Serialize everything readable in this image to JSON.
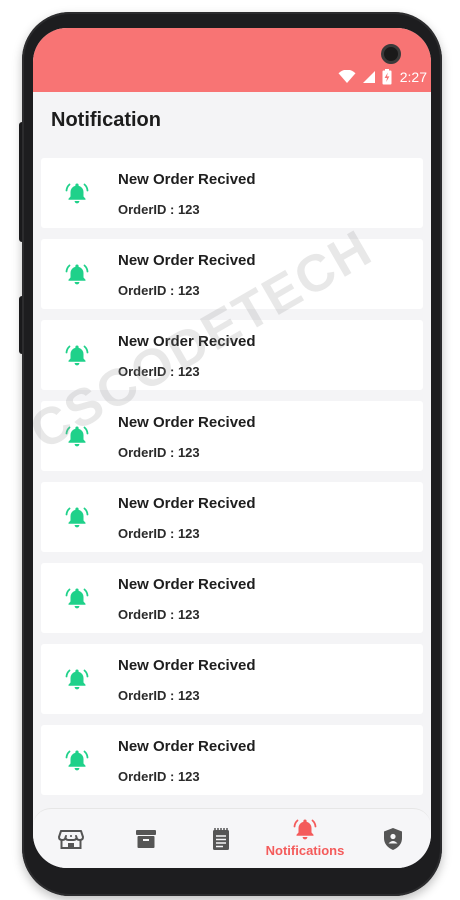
{
  "status_bar": {
    "time": "2:27",
    "wifi_icon": "wifi-icon",
    "signal_icon": "signal-icon",
    "battery_icon": "battery-charging-icon"
  },
  "header": {
    "title": "Notification"
  },
  "notifications": [
    {
      "title": "New Order Recived",
      "subtitle": "OrderID : 123",
      "icon": "bell-icon"
    },
    {
      "title": "New Order Recived",
      "subtitle": "OrderID : 123",
      "icon": "bell-icon"
    },
    {
      "title": "New Order Recived",
      "subtitle": "OrderID : 123",
      "icon": "bell-icon"
    },
    {
      "title": "New Order Recived",
      "subtitle": "OrderID : 123",
      "icon": "bell-icon"
    },
    {
      "title": "New Order Recived",
      "subtitle": "OrderID : 123",
      "icon": "bell-icon"
    },
    {
      "title": "New Order Recived",
      "subtitle": "OrderID : 123",
      "icon": "bell-icon"
    },
    {
      "title": "New Order Recived",
      "subtitle": "OrderID : 123",
      "icon": "bell-icon"
    },
    {
      "title": "New Order Recived",
      "subtitle": "OrderID : 123",
      "icon": "bell-icon"
    }
  ],
  "bottom_nav": {
    "items": [
      {
        "icon": "store-icon"
      },
      {
        "icon": "archive-box-icon"
      },
      {
        "icon": "notepad-icon"
      },
      {
        "icon": "bell-icon",
        "label": "Notifications",
        "active": true
      },
      {
        "icon": "shield-user-icon"
      }
    ]
  },
  "watermark": "CSCODETECH",
  "colors": {
    "accent": "#f87474",
    "bell_green": "#1fd18a",
    "active_nav": "#f45b5b",
    "inactive_nav": "#555555"
  }
}
